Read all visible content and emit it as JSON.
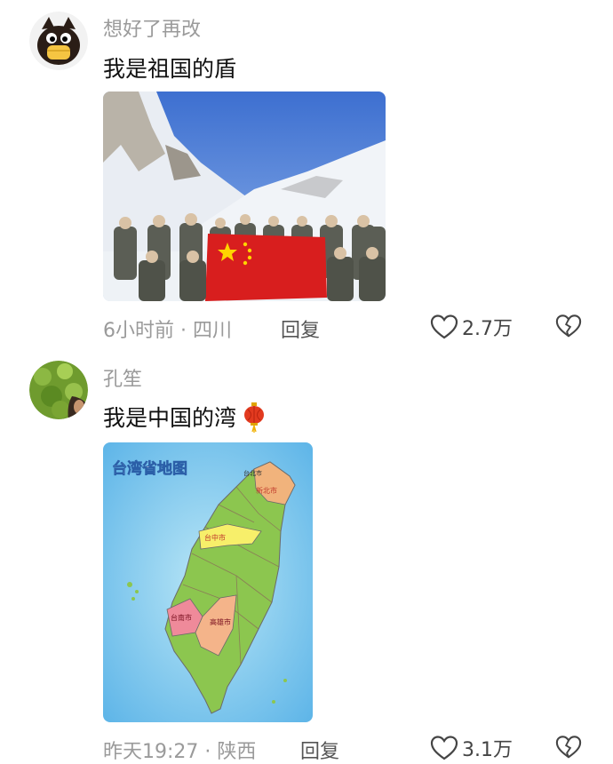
{
  "comments": [
    {
      "username": "想好了再改",
      "text": "我是祖国的盾",
      "time": "6小时前",
      "location": "四川",
      "reply": "回复",
      "likes": "2.7万",
      "avatar_icon": "cartoon-bird-avatar",
      "image_icon": "soldiers-with-flag-photo"
    },
    {
      "username": "孔笙",
      "text": "我是中国的湾",
      "emoji_icon": "red-lantern-icon",
      "time": "昨天19:27",
      "location": "陕西",
      "reply": "回复",
      "likes": "3.1万",
      "avatar_icon": "green-leaves-avatar",
      "image_icon": "taiwan-map-image",
      "map_title": "台湾省地图",
      "map_labels": {
        "taipei": "台北市",
        "newtaipei": "新北市",
        "taichung": "台中市",
        "tainan": "台南市",
        "kaohsiung": "高雄市"
      }
    }
  ],
  "colors": {
    "meta": "#9a9a9a",
    "text": "#111111",
    "flag": "#d81e1e"
  }
}
